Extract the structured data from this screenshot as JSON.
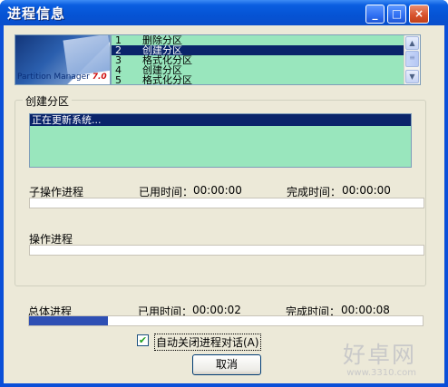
{
  "window": {
    "title": "进程信息",
    "buttons": {
      "minimize": "_",
      "maximize": "□",
      "close": "×"
    }
  },
  "logo": {
    "product": "Partition Manager",
    "version": "7.0"
  },
  "steps": [
    {
      "num": "1",
      "label": "删除分区",
      "selected": false
    },
    {
      "num": "2",
      "label": "创建分区",
      "selected": true
    },
    {
      "num": "3",
      "label": "格式化分区",
      "selected": false
    },
    {
      "num": "4",
      "label": "创建分区",
      "selected": false
    },
    {
      "num": "5",
      "label": "格式化分区",
      "selected": false
    }
  ],
  "current_group": {
    "label": "创建分区",
    "log_lines": [
      "正在更新系统..."
    ]
  },
  "sub_progress": {
    "label": "子操作进程",
    "elapsed_label": "已用时间：",
    "elapsed": "00:00:00",
    "remaining_label": "完成时间：",
    "remaining": "00:00:00",
    "fraction": 0
  },
  "op_progress": {
    "label": "操作进程",
    "fraction": 0
  },
  "total_progress": {
    "label": "总体进程",
    "elapsed_label": "已用时间：",
    "elapsed": "00:00:02",
    "remaining_label": "完成时间：",
    "remaining": "00:00:08",
    "fraction": 0.2
  },
  "auto_close": {
    "label": "自动关闭进程对话(A)",
    "checked": true,
    "check_glyph": "✔"
  },
  "cancel_button": "取消",
  "watermark": {
    "main": "好卓网",
    "url": "www.3310.com"
  },
  "colors": {
    "title_bar": "#0553d4",
    "list_bg": "#99e6bd",
    "selection": "#0a246a",
    "progress_fill": "#2e4fb4",
    "dialog_bg": "#ece9d8"
  }
}
